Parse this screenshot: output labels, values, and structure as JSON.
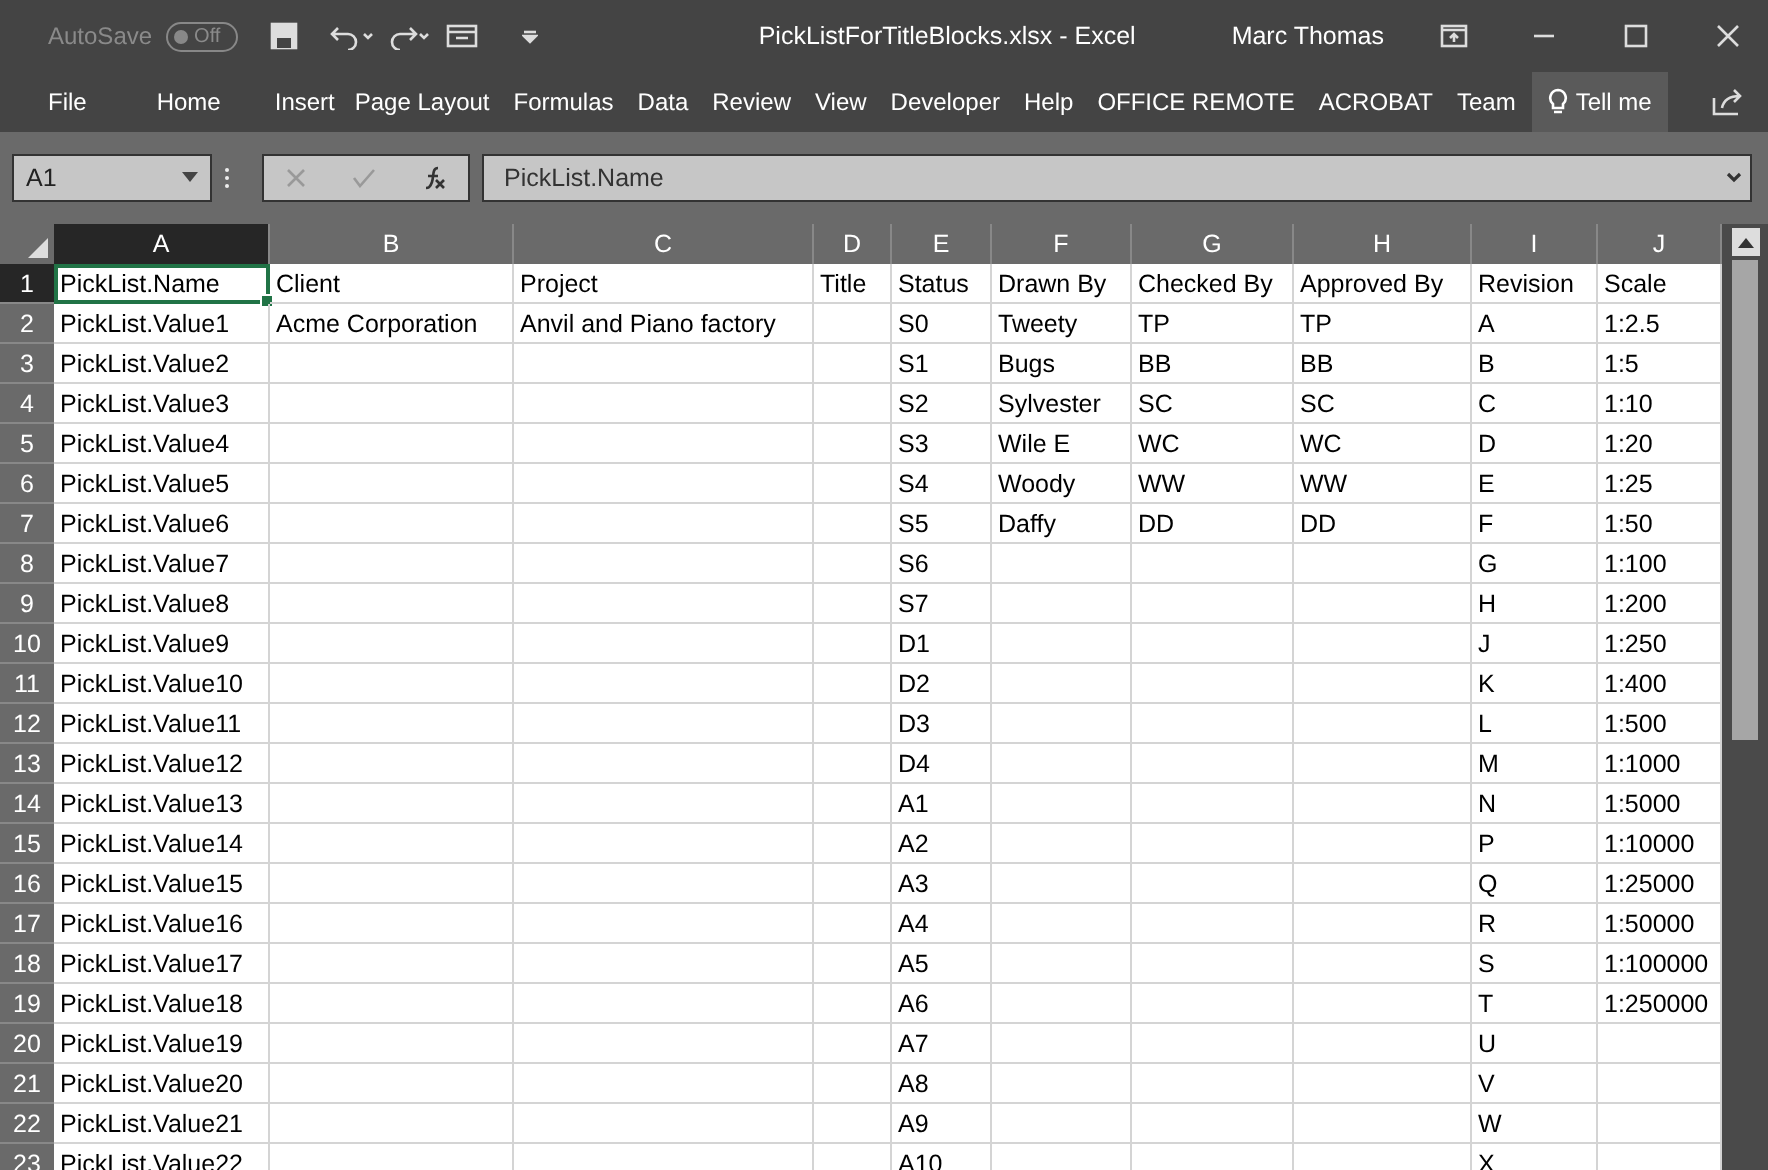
{
  "title_bar": {
    "autosave": {
      "label": "AutoSave",
      "state_text": "Off",
      "on": false
    },
    "document_title": "PickListForTitleBlocks.xlsx  -  Excel",
    "user": "Marc Thomas"
  },
  "ribbon_tabs": [
    {
      "label": "File",
      "selected": false
    },
    {
      "label": "Home",
      "selected": false
    },
    {
      "label": "Insert",
      "selected": false
    },
    {
      "label": "Page Layout",
      "selected": false
    },
    {
      "label": "Formulas",
      "selected": false
    },
    {
      "label": "Data",
      "selected": false
    },
    {
      "label": "Review",
      "selected": false
    },
    {
      "label": "View",
      "selected": false
    },
    {
      "label": "Developer",
      "selected": false
    },
    {
      "label": "Help",
      "selected": false
    },
    {
      "label": "OFFICE REMOTE",
      "selected": false
    },
    {
      "label": "ACROBAT",
      "selected": false
    },
    {
      "label": "Team",
      "selected": false
    }
  ],
  "tell_me": {
    "label": "Tell me"
  },
  "formula_bar": {
    "name_box": "A1",
    "content": "PickList.Name"
  },
  "columns": [
    {
      "label": "A",
      "selected": true
    },
    {
      "label": "B",
      "selected": false
    },
    {
      "label": "C",
      "selected": false
    },
    {
      "label": "D",
      "selected": false
    },
    {
      "label": "E",
      "selected": false
    },
    {
      "label": "F",
      "selected": false
    },
    {
      "label": "G",
      "selected": false
    },
    {
      "label": "H",
      "selected": false
    },
    {
      "label": "I",
      "selected": false
    },
    {
      "label": "J",
      "selected": false
    }
  ],
  "rows": [
    {
      "number": "1",
      "selected": true,
      "cells": [
        "PickList.Name",
        "Client",
        "Project",
        "Title",
        "Status",
        "Drawn By",
        "Checked By",
        "Approved By",
        "Revision",
        "Scale"
      ]
    },
    {
      "number": "2",
      "selected": false,
      "cells": [
        "PickList.Value1",
        "Acme Corporation",
        "Anvil and Piano factory",
        null,
        "S0",
        "Tweety",
        "TP",
        "TP",
        "A",
        "1:2.5"
      ]
    },
    {
      "number": "3",
      "selected": false,
      "cells": [
        "PickList.Value2",
        null,
        null,
        null,
        "S1",
        "Bugs",
        "BB",
        "BB",
        "B",
        "1:5"
      ]
    },
    {
      "number": "4",
      "selected": false,
      "cells": [
        "PickList.Value3",
        null,
        null,
        null,
        "S2",
        "Sylvester",
        "SC",
        "SC",
        "C",
        "1:10"
      ]
    },
    {
      "number": "5",
      "selected": false,
      "cells": [
        "PickList.Value4",
        null,
        null,
        null,
        "S3",
        "Wile E",
        "WC",
        "WC",
        "D",
        "1:20"
      ]
    },
    {
      "number": "6",
      "selected": false,
      "cells": [
        "PickList.Value5",
        null,
        null,
        null,
        "S4",
        "Woody",
        "WW",
        "WW",
        "E",
        "1:25"
      ]
    },
    {
      "number": "7",
      "selected": false,
      "cells": [
        "PickList.Value6",
        null,
        null,
        null,
        "S5",
        "Daffy",
        "DD",
        "DD",
        "F",
        "1:50"
      ]
    },
    {
      "number": "8",
      "selected": false,
      "cells": [
        "PickList.Value7",
        null,
        null,
        null,
        "S6",
        null,
        null,
        null,
        "G",
        "1:100"
      ]
    },
    {
      "number": "9",
      "selected": false,
      "cells": [
        "PickList.Value8",
        null,
        null,
        null,
        "S7",
        null,
        null,
        null,
        "H",
        "1:200"
      ]
    },
    {
      "number": "10",
      "selected": false,
      "cells": [
        "PickList.Value9",
        null,
        null,
        null,
        "D1",
        null,
        null,
        null,
        "J",
        "1:250"
      ]
    },
    {
      "number": "11",
      "selected": false,
      "cells": [
        "PickList.Value10",
        null,
        null,
        null,
        "D2",
        null,
        null,
        null,
        "K",
        "1:400"
      ]
    },
    {
      "number": "12",
      "selected": false,
      "cells": [
        "PickList.Value11",
        null,
        null,
        null,
        "D3",
        null,
        null,
        null,
        "L",
        "1:500"
      ]
    },
    {
      "number": "13",
      "selected": false,
      "cells": [
        "PickList.Value12",
        null,
        null,
        null,
        "D4",
        null,
        null,
        null,
        "M",
        "1:1000"
      ]
    },
    {
      "number": "14",
      "selected": false,
      "cells": [
        "PickList.Value13",
        null,
        null,
        null,
        "A1",
        null,
        null,
        null,
        "N",
        "1:5000"
      ]
    },
    {
      "number": "15",
      "selected": false,
      "cells": [
        "PickList.Value14",
        null,
        null,
        null,
        "A2",
        null,
        null,
        null,
        "P",
        "1:10000"
      ]
    },
    {
      "number": "16",
      "selected": false,
      "cells": [
        "PickList.Value15",
        null,
        null,
        null,
        "A3",
        null,
        null,
        null,
        "Q",
        "1:25000"
      ]
    },
    {
      "number": "17",
      "selected": false,
      "cells": [
        "PickList.Value16",
        null,
        null,
        null,
        "A4",
        null,
        null,
        null,
        "R",
        "1:50000"
      ]
    },
    {
      "number": "18",
      "selected": false,
      "cells": [
        "PickList.Value17",
        null,
        null,
        null,
        "A5",
        null,
        null,
        null,
        "S",
        "1:100000"
      ]
    },
    {
      "number": "19",
      "selected": false,
      "cells": [
        "PickList.Value18",
        null,
        null,
        null,
        "A6",
        null,
        null,
        null,
        "T",
        "1:250000"
      ]
    },
    {
      "number": "20",
      "selected": false,
      "cells": [
        "PickList.Value19",
        null,
        null,
        null,
        "A7",
        null,
        null,
        null,
        "U",
        null
      ]
    },
    {
      "number": "21",
      "selected": false,
      "cells": [
        "PickList.Value20",
        null,
        null,
        null,
        "A8",
        null,
        null,
        null,
        "V",
        null
      ]
    },
    {
      "number": "22",
      "selected": false,
      "cells": [
        "PickList.Value21",
        null,
        null,
        null,
        "A9",
        null,
        null,
        null,
        "W",
        null
      ]
    },
    {
      "number": "23",
      "selected": false,
      "cells": [
        "PickList.Value22",
        null,
        null,
        null,
        "A10",
        null,
        null,
        null,
        "X",
        null
      ]
    }
  ]
}
